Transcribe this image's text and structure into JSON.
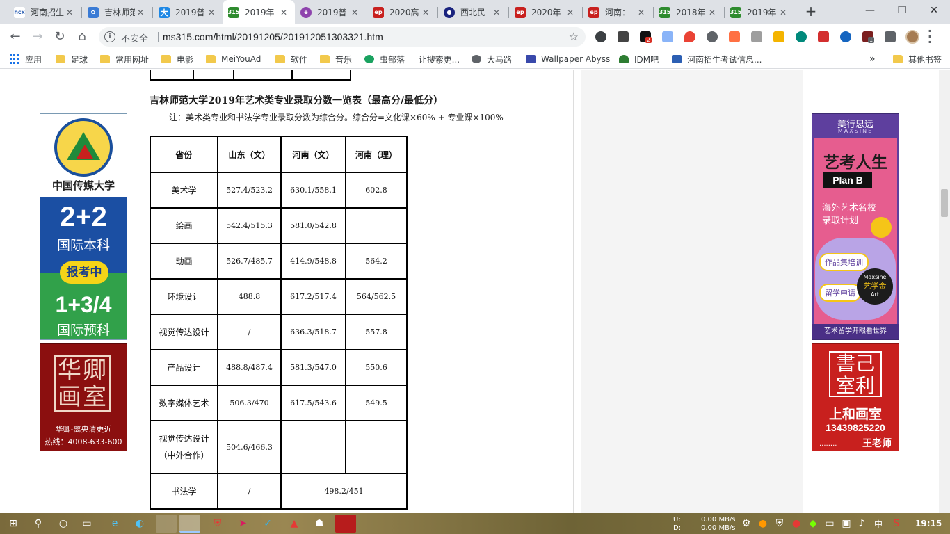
{
  "browser": {
    "tabs": [
      {
        "title": "河南招生",
        "favicon": "hncx-icon",
        "color": "#2c5fb3",
        "active": false
      },
      {
        "title": "吉林师范",
        "favicon": "paw-icon",
        "color": "#3a7bd5",
        "active": false
      },
      {
        "title": "2019普",
        "favicon": "da-icon",
        "color": "#1e88e5",
        "active": false
      },
      {
        "title": "2019年",
        "favicon": "ms315-icon",
        "color": "#2e8b2e",
        "active": true
      },
      {
        "title": "2019普",
        "favicon": "swirl-icon",
        "color": "#8e44ad",
        "active": false
      },
      {
        "title": "2020高",
        "favicon": "eol-icon",
        "color": "#c8201e",
        "active": false
      },
      {
        "title": "西北民",
        "favicon": "nwmu-icon",
        "color": "#1a237e",
        "active": false
      },
      {
        "title": "2020年",
        "favicon": "eol-icon",
        "color": "#c8201e",
        "active": false
      },
      {
        "title": "河南：",
        "favicon": "eol-icon",
        "color": "#c8201e",
        "active": false
      },
      {
        "title": "2018年",
        "favicon": "ms315-icon",
        "color": "#2e8b2e",
        "active": false
      },
      {
        "title": "2019年",
        "favicon": "ms315-icon",
        "color": "#2e8b2e",
        "active": false
      }
    ],
    "tab_close_glyph": "✕",
    "new_tab_glyph": "+",
    "window_controls": {
      "minimize": "—",
      "restore": "❐",
      "close": "✕"
    },
    "omnibox": {
      "security_label": "不安全",
      "url": "ms315.com/html/20191205/201912051303321.htm"
    },
    "extension_badges": {
      "ext2": "2",
      "ext15": "1"
    },
    "bookmarks": [
      {
        "label": "应用",
        "icon": "apps-icon"
      },
      {
        "label": "足球",
        "icon": "folder-icon"
      },
      {
        "label": "常用网址",
        "icon": "folder-icon"
      },
      {
        "label": "电影",
        "icon": "folder-icon"
      },
      {
        "label": "MeiYouAd",
        "icon": "folder-icon"
      },
      {
        "label": "软件",
        "icon": "folder-icon"
      },
      {
        "label": "音乐",
        "icon": "folder-icon"
      },
      {
        "label": "虫部落 — 让搜索更...",
        "icon": "bug-icon"
      },
      {
        "label": "大马路",
        "icon": "globe-icon"
      },
      {
        "label": "Wallpaper Abyss",
        "icon": "wallpaper-icon"
      },
      {
        "label": "IDM吧",
        "icon": "tree-icon"
      },
      {
        "label": "河南招生考试信息...",
        "icon": "hncx-icon"
      }
    ],
    "bookmarks_overflow": "»",
    "other_bookmarks": "其他书签"
  },
  "article": {
    "title": "吉林师范大学2019年艺术类专业录取分数一览表（最高分/最低分）",
    "note": "注：美术类专业和书法学专业录取分数为综合分。综合分=文化课×60% + 专业课×100%"
  },
  "table": {
    "headers": [
      "省份",
      "山东（文）",
      "河南（文）",
      "河南（理）"
    ],
    "rows": [
      {
        "major": "美术学",
        "sd_wen": "527.4/523.2",
        "hn_wen": "630.1/558.1",
        "hn_li": "602.8"
      },
      {
        "major": "绘画",
        "sd_wen": "542.4/515.3",
        "hn_wen": "581.0/542.8",
        "hn_li": ""
      },
      {
        "major": "动画",
        "sd_wen": "526.7/485.7",
        "hn_wen": "414.9/548.8",
        "hn_li": "564.2"
      },
      {
        "major": "环境设计",
        "sd_wen": "488.8",
        "hn_wen": "617.2/517.4",
        "hn_li": "564/562.5"
      },
      {
        "major": "视觉传达设计",
        "sd_wen": "/",
        "hn_wen": "636.3/518.7",
        "hn_li": "557.8"
      },
      {
        "major": "产品设计",
        "sd_wen": "488.8/487.4",
        "hn_wen": "581.3/547.0",
        "hn_li": "550.6"
      },
      {
        "major": "数字媒体艺术",
        "sd_wen": "506.3/470",
        "hn_wen": "617.5/543.6",
        "hn_li": "549.5"
      }
    ],
    "row_coop": {
      "major_line1": "视觉传达设计",
      "major_line2": "（中外合作）",
      "sd_wen": "504.6/466.3",
      "hn_wen": "",
      "hn_li": ""
    },
    "row_shufa": {
      "major": "书法学",
      "sd_wen": "/",
      "hn_merged": "498.2/451"
    }
  },
  "ads": {
    "cuc": {
      "name": "中国传媒大学",
      "big1": "2+2",
      "sub1": "国际本科",
      "badge": "报考中",
      "big2": "1+3/4",
      "sub2": "国际预科"
    },
    "huaqing": {
      "seal": "华卿画室",
      "line1": "华卿-离央清更近",
      "line2": "热线：4008-633-600"
    },
    "maxsine": {
      "brand": "美行思远",
      "brand_en": "MAXSINE",
      "head": "艺考人生",
      "planb": "Plan B",
      "text1": "海外艺术名校",
      "text2": "录取计划",
      "pill1": "作品集培训",
      "pill2": "留学申请",
      "circle1": "Maxsine",
      "circle2": "艺学金",
      "circle3": "Art",
      "foot": "艺术留学开眼看世界"
    },
    "shanghe": {
      "seal": "書己室利",
      "name": "上和画室",
      "phone": "13439825220",
      "dots": "........",
      "teacher": "王老师"
    }
  },
  "taskbar": {
    "drive_u": "U:",
    "drive_d": "D:",
    "speed_up": "0.00 MB/s",
    "speed_down": "0.00 MB/s",
    "ime": "中",
    "time": "19:15"
  }
}
